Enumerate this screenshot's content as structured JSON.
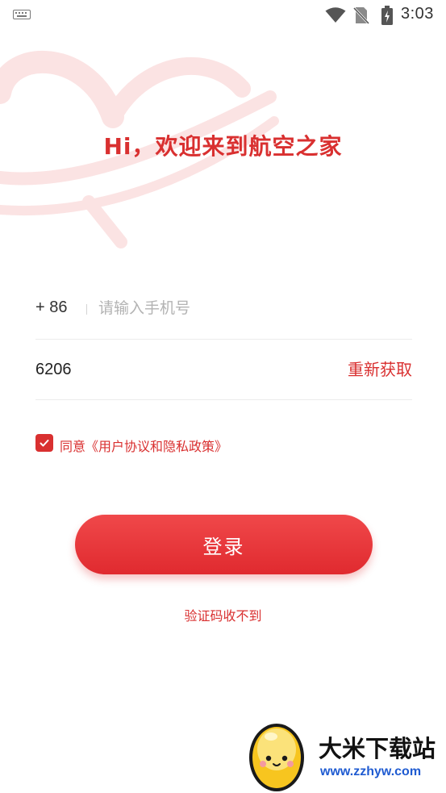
{
  "status_bar": {
    "time": "3:03",
    "icons": [
      "keyboard-icon",
      "wifi-icon",
      "no-sim-icon",
      "battery-icon"
    ]
  },
  "welcome": {
    "greeting": "Hi，欢迎来到航空之家"
  },
  "form": {
    "country_code": "+ 86",
    "phone_placeholder": "请输入手机号",
    "phone_value": "",
    "code_value": "6206",
    "resend_label": "重新获取",
    "agreement_checked": true,
    "agreement_text": "同意《用户协议和隐私政策》"
  },
  "actions": {
    "login_label": "登录",
    "no_code_label": "验证码收不到"
  },
  "watermark": {
    "title": "大米下载站",
    "url": "www.zzhyw.com"
  },
  "colors": {
    "accent": "#d93030",
    "button": "#e83a3d",
    "placeholder": "#b3b3b3",
    "divider": "#ececec"
  }
}
